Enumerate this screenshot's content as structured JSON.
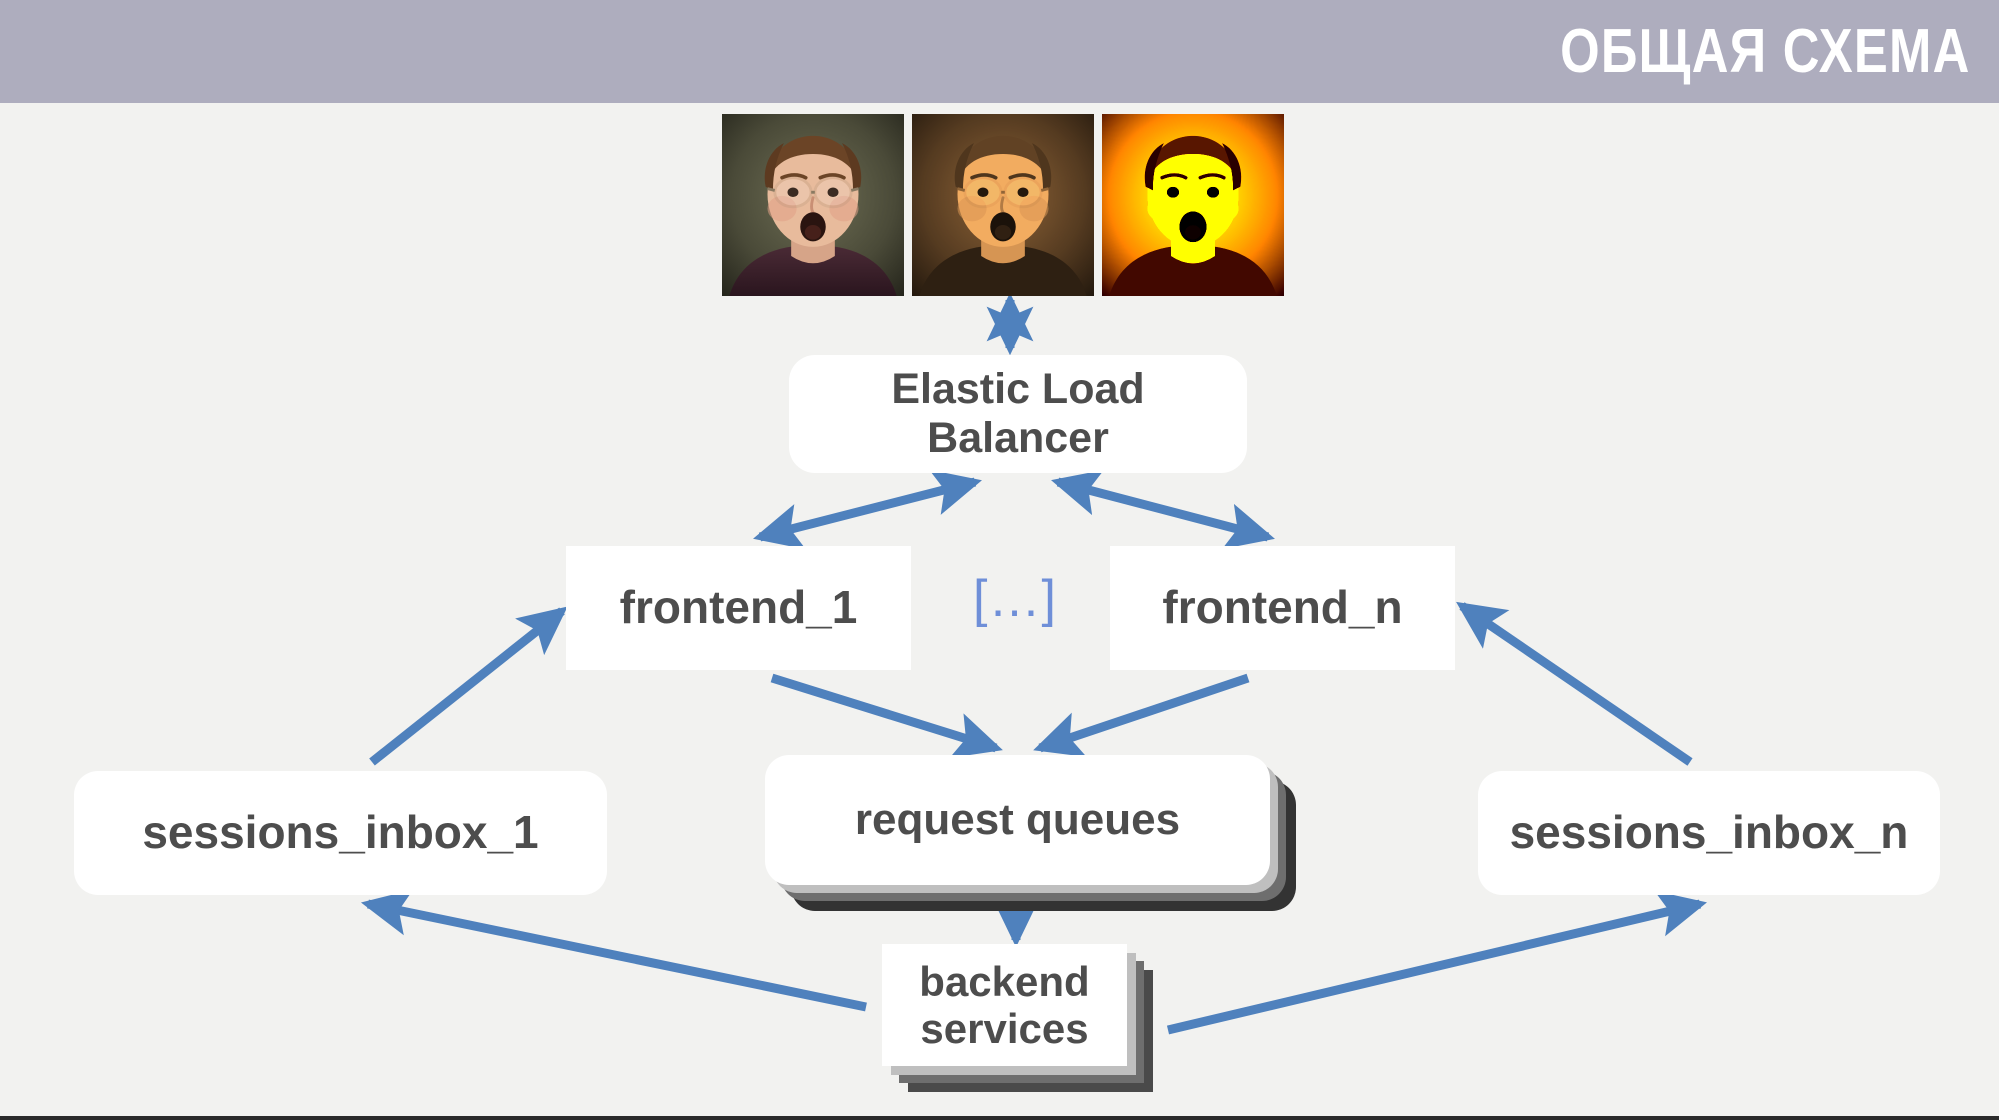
{
  "header": {
    "title": "ОБЩАЯ СХЕМА",
    "band_color": "#aeadbe",
    "title_color": "#ffffff"
  },
  "canvas": {
    "background_color": "#f2f2f0",
    "accent_arrow_color": "#4f81bd",
    "ellipsis_color": "#6f8fd8",
    "node_text_color": "#4d4d4d",
    "node_fill_color": "#ffffff"
  },
  "clients": {
    "label": "client face thumbnails",
    "items": [
      {
        "name": "client-thumb-normal",
        "grading": "normal"
      },
      {
        "name": "client-thumb-sepia",
        "grading": "sepia"
      },
      {
        "name": "client-thumb-yellow",
        "grading": "yellow"
      }
    ]
  },
  "nodes": {
    "elb": {
      "label": "Elastic Load Balancer",
      "shape": "rounded-rect"
    },
    "frontend_1": {
      "label": "frontend_1",
      "shape": "rect"
    },
    "frontend_n": {
      "label": "frontend_n",
      "shape": "rect"
    },
    "ellipsis": {
      "label": "[…]"
    },
    "sessions_inbox_1": {
      "label": "sessions_inbox_1",
      "shape": "rounded-rect"
    },
    "sessions_inbox_n": {
      "label": "sessions_inbox_n",
      "shape": "rounded-rect"
    },
    "request_queues": {
      "label": "request queues",
      "shape": "stacked-rounded-rect"
    },
    "backend_services": {
      "label": "backend services",
      "shape": "stacked-rect"
    }
  },
  "connections": [
    {
      "from": "clients",
      "to": "elb",
      "direction": "bidirectional"
    },
    {
      "from": "elb",
      "to": "frontend_1",
      "direction": "bidirectional"
    },
    {
      "from": "elb",
      "to": "frontend_n",
      "direction": "bidirectional"
    },
    {
      "from": "frontend_1",
      "to": "request_queues",
      "direction": "one-way"
    },
    {
      "from": "frontend_n",
      "to": "request_queues",
      "direction": "one-way"
    },
    {
      "from": "request_queues",
      "to": "backend_services",
      "direction": "one-way"
    },
    {
      "from": "backend_services",
      "to": "sessions_inbox_1",
      "direction": "one-way"
    },
    {
      "from": "backend_services",
      "to": "sessions_inbox_n",
      "direction": "one-way"
    },
    {
      "from": "sessions_inbox_1",
      "to": "frontend_1",
      "direction": "one-way"
    },
    {
      "from": "sessions_inbox_n",
      "to": "frontend_n",
      "direction": "one-way"
    }
  ]
}
